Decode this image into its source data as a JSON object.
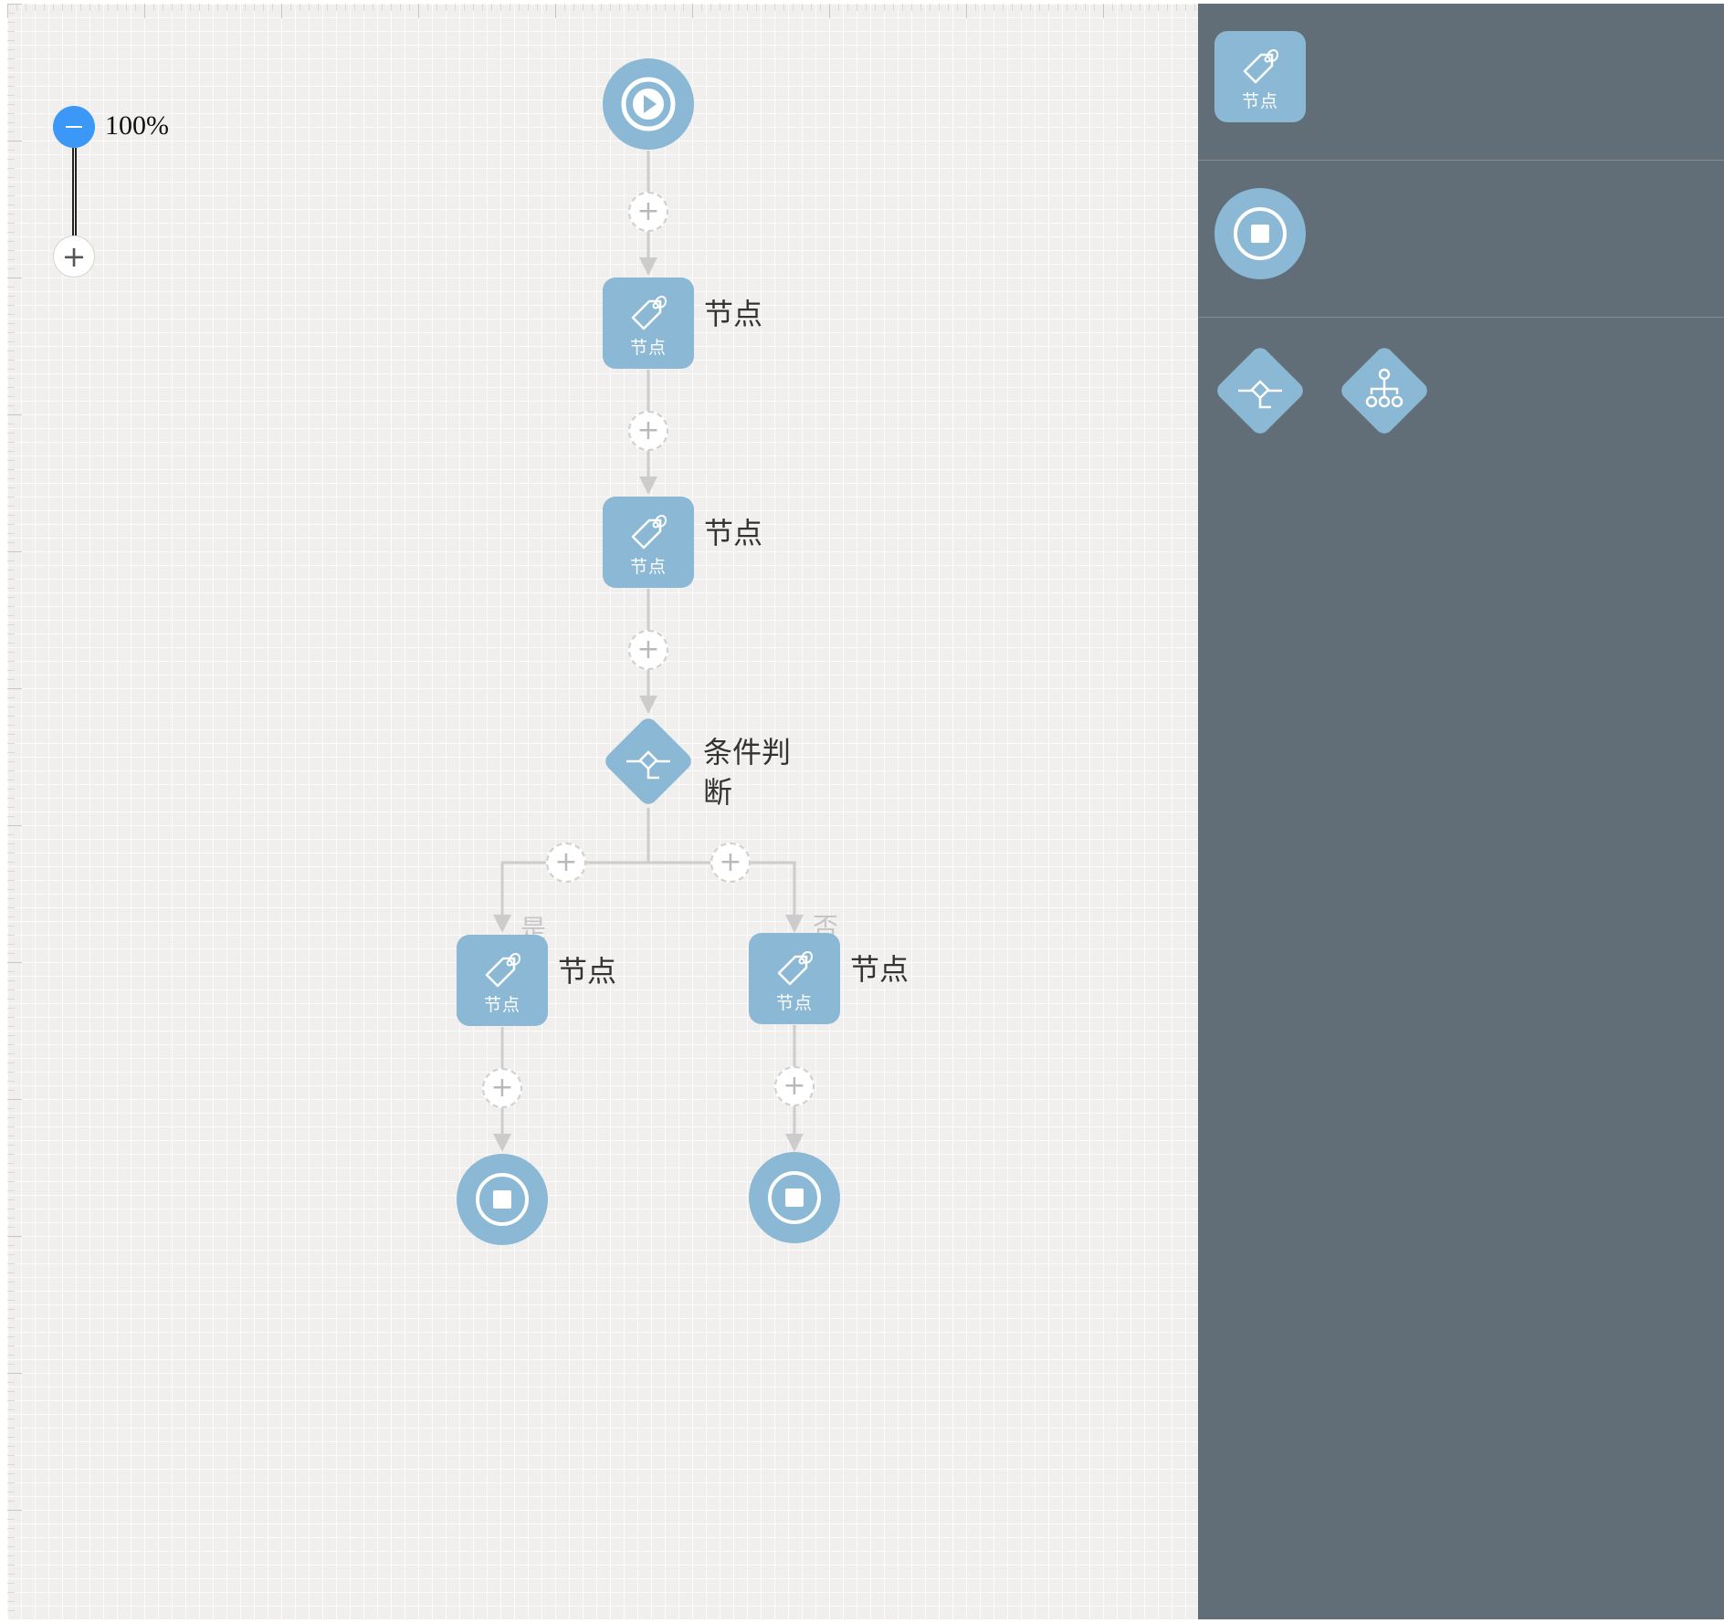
{
  "canvas": {
    "zoom": {
      "value": "100%",
      "minus_icon": "minus-icon",
      "plus_icon": "plus-icon",
      "plus_symbol": "+"
    },
    "start_node": {
      "icon": "play-icon"
    },
    "nodes": [
      {
        "id": "node-1",
        "inner_label": "节点",
        "label": "节点",
        "icon": "tag-icon"
      },
      {
        "id": "node-2",
        "inner_label": "节点",
        "label": "节点",
        "icon": "tag-icon"
      },
      {
        "id": "node-yes",
        "inner_label": "节点",
        "label": "节点",
        "icon": "tag-icon"
      },
      {
        "id": "node-no",
        "inner_label": "节点",
        "label": "节点",
        "icon": "tag-icon"
      }
    ],
    "condition": {
      "label_line1": "条件判",
      "label_line2": "断",
      "icon": "condition-icon"
    },
    "branches": {
      "yes": "是",
      "no": "否"
    },
    "end_nodes": [
      {
        "icon": "stop-icon"
      },
      {
        "icon": "stop-icon"
      }
    ],
    "add_button_symbol": "+"
  },
  "palette": {
    "items": [
      {
        "name": "node",
        "inner_label": "节点",
        "icon": "tag-icon"
      },
      {
        "name": "end",
        "icon": "stop-icon"
      },
      {
        "name": "condition",
        "icon": "condition-icon"
      },
      {
        "name": "parallel",
        "icon": "branch-tree-icon"
      }
    ]
  },
  "colors": {
    "node_fill": "#8bb8d5",
    "canvas_bg": "#f1efee",
    "palette_bg": "#616d77",
    "zoom_accent": "#3b98f6",
    "connector": "#cccccc"
  }
}
